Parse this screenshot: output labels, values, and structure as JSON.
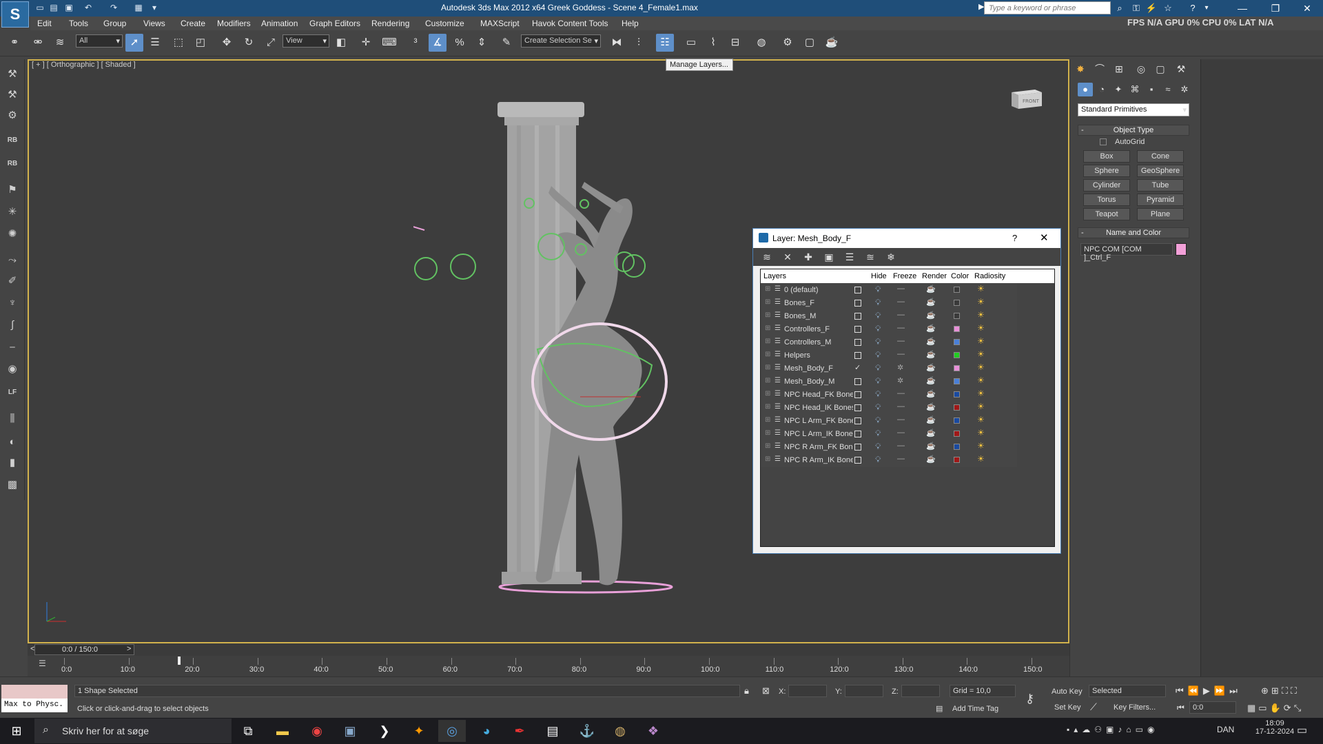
{
  "app": {
    "logo": "S",
    "title": "Autodesk 3ds Max  2012 x64       Greek Goddess - Scene 4_Female1.max",
    "search_placeholder": "Type a keyword or phrase",
    "stats": {
      "fps_label": "FPS",
      "fps": "N/A",
      "gpu_label": "GPU",
      "gpu": "0%",
      "cpu_label": "CPU",
      "cpu": "0%",
      "lat_label": "LAT",
      "lat": "N/A"
    }
  },
  "menu": [
    "Edit",
    "Tools",
    "Group",
    "Views",
    "Create",
    "Modifiers",
    "Animation",
    "Graph Editors",
    "Rendering",
    "Customize",
    "MAXScript",
    "Havok Content Tools",
    "Help"
  ],
  "toolbar": {
    "selection_filter": "All",
    "ref_coord": "View",
    "named_selection": "Create Selection Se",
    "tooltip": "Manage Layers..."
  },
  "viewport": {
    "label": "[ + ] [ Orthographic ] [ Shaded ]",
    "viewcube_label": "FRONT"
  },
  "timeline": {
    "slider_text": "0:0 / 150:0",
    "prev": "<",
    "next": ">",
    "labels": [
      "0:0",
      "10:0",
      "20:0",
      "30:0",
      "40:0",
      "50:0",
      "60:0",
      "70:0",
      "80:0",
      "90:0",
      "100:0",
      "110:0",
      "120:0",
      "130:0",
      "140:0",
      "150:0"
    ]
  },
  "status": {
    "maxscript": "Max to Physc.",
    "selection": "1 Shape Selected",
    "prompt": "Click or click-and-drag to select objects",
    "x_label": "X:",
    "y_label": "Y:",
    "z_label": "Z:",
    "grid": "Grid = 10,0",
    "add_time_tag": "Add Time Tag",
    "auto_key": "Auto Key",
    "set_key": "Set Key",
    "key_mode": "Selected",
    "key_filters": "Key Filters...",
    "frame": "0:0"
  },
  "command_panel": {
    "category": "Standard Primitives",
    "object_type_title": "Object Type",
    "autogrid": "AutoGrid",
    "primitives": [
      "Box",
      "Cone",
      "Sphere",
      "GeoSphere",
      "Cylinder",
      "Tube",
      "Torus",
      "Pyramid",
      "Teapot",
      "Plane"
    ],
    "name_color_title": "Name and Color",
    "object_name": "NPC COM [COM ]_Ctrl_F",
    "object_color": "#f2a0d8"
  },
  "layer_dialog": {
    "title": "Layer: Mesh_Body_F",
    "help": "?",
    "close": "✕",
    "columns": [
      "Layers",
      "Hide",
      "Freeze",
      "Render",
      "Color",
      "Radiosity"
    ],
    "rows": [
      {
        "name": "0 (default)",
        "color": "#3a3a3a",
        "current": false
      },
      {
        "name": "Bones_F",
        "color": "#3a3a3a",
        "current": false
      },
      {
        "name": "Bones_M",
        "color": "#3a3a3a",
        "current": false
      },
      {
        "name": "Controllers_F",
        "color": "#e890d8",
        "current": false
      },
      {
        "name": "Controllers_M",
        "color": "#4a80d8",
        "current": false
      },
      {
        "name": "Helpers",
        "color": "#22cc22",
        "current": false
      },
      {
        "name": "Mesh_Body_F",
        "color": "#e890d8",
        "current": true
      },
      {
        "name": "Mesh_Body_M",
        "color": "#4a80d8",
        "current": false
      },
      {
        "name": "NPC Head_FK Bones",
        "color": "#1a4aa0",
        "current": false
      },
      {
        "name": "NPC Head_IK Bones",
        "color": "#a01818",
        "current": false
      },
      {
        "name": "NPC L Arm_FK Bones",
        "color": "#1a4aa0",
        "current": false
      },
      {
        "name": "NPC L Arm_IK Bones",
        "color": "#a01818",
        "current": false
      },
      {
        "name": "NPC R Arm_FK Bones",
        "color": "#1a4aa0",
        "current": false
      },
      {
        "name": "NPC R Arm_IK Bones",
        "color": "#a01818",
        "current": false
      }
    ]
  },
  "taskbar": {
    "search": "Skriv her for at søge",
    "lang": "DAN",
    "time": "18:09",
    "date": "17-12-2024"
  }
}
